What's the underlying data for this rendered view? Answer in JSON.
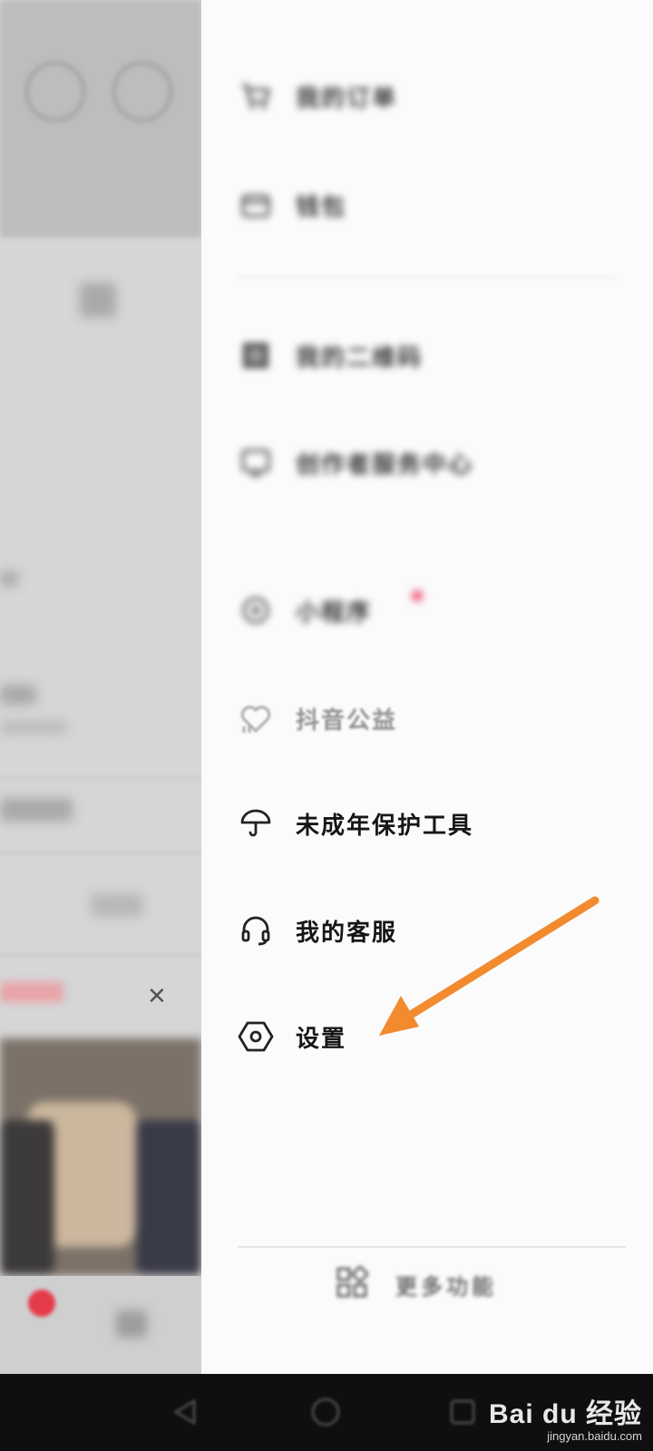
{
  "drawer": {
    "items": [
      {
        "label": "我的订单",
        "icon": "cart-icon"
      },
      {
        "label": "钱包",
        "icon": "wallet-icon"
      },
      {
        "label": "我的二维码",
        "icon": "qrcode-icon"
      },
      {
        "label": "创作者服务中心",
        "icon": "creator-icon"
      },
      {
        "label": "小程序",
        "icon": "miniapp-icon"
      },
      {
        "label": "抖音公益",
        "icon": "heart-charity-icon"
      },
      {
        "label": "未成年保护工具",
        "icon": "umbrella-icon"
      },
      {
        "label": "我的客服",
        "icon": "headset-icon"
      },
      {
        "label": "设置",
        "icon": "settings-hexagon-icon"
      }
    ],
    "more_label": "更多功能"
  },
  "background": {
    "close_glyph": "✕",
    "tab_label": "收藏"
  },
  "watermark": {
    "logo": "Bai du 经验",
    "url": "jingyan.baidu.com"
  },
  "colors": {
    "arrow": "#f28a2e",
    "drawer_bg": "#fbfbfb",
    "badge": "#e53a4a"
  }
}
